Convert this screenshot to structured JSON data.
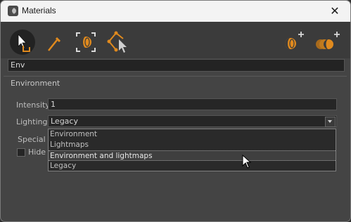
{
  "window": {
    "title": "Materials",
    "close_glyph": "✕"
  },
  "toolbar": {
    "tools": [
      {
        "name": "select-material-icon",
        "active": true
      },
      {
        "name": "eyedropper-icon",
        "active": false
      },
      {
        "name": "focus-material-icon",
        "active": false
      },
      {
        "name": "pick-node-icon",
        "active": false
      },
      {
        "name": "add-material-icon",
        "active": false
      },
      {
        "name": "add-multi-material-icon",
        "active": false
      }
    ],
    "accent": "#e08a1e"
  },
  "material_name": "Env",
  "environment": {
    "group_title": "Environment",
    "intensity_label": "Intensity:",
    "intensity_value": "1",
    "lighting_label": "Lighting:",
    "lighting_value": "Legacy",
    "special_label": "Special E",
    "hide_label": "Hide s"
  },
  "dropdown": {
    "options": [
      "Environment",
      "Lightmaps",
      "Environment and lightmaps",
      "Legacy"
    ],
    "highlighted_index": 2
  }
}
